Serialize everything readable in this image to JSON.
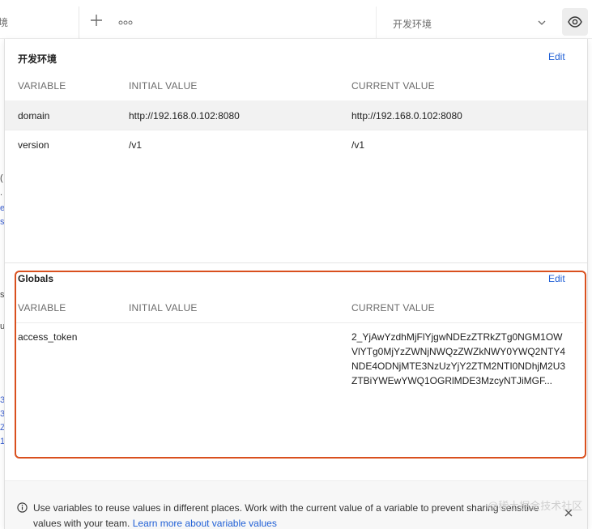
{
  "topbar": {
    "tab_fragment": "境",
    "environment_selected": "开发环境"
  },
  "background_peek": [
    "(",
    ".",
    "e",
    "s",
    "s",
    "u",
    "3",
    "3",
    "Z",
    "1"
  ],
  "environment": {
    "title": "开发环境",
    "edit_label": "Edit",
    "columns": [
      "VARIABLE",
      "INITIAL VALUE",
      "CURRENT VALUE"
    ],
    "rows": [
      {
        "variable": "domain",
        "initial": "http://192.168.0.102:8080",
        "current": "http://192.168.0.102:8080"
      },
      {
        "variable": "version",
        "initial": "/v1",
        "current": "/v1"
      }
    ]
  },
  "globals": {
    "title": "Globals",
    "edit_label": "Edit",
    "columns": [
      "VARIABLE",
      "INITIAL VALUE",
      "CURRENT VALUE"
    ],
    "rows": [
      {
        "variable": "access_token",
        "initial": "",
        "current": "2_YjAwYzdhMjFlYjgwNDEzZTRkZTg0NGM1OWVlYTg0MjYzZWNjNWQzZWZkNWY0YWQ2NTY4NDE4ODNjMTE3NzUzYjY2ZTM2NTI0NDhjM2U3ZTBiYWEwYWQ1OGRlMDE3MzcyNTJiMGF..."
      }
    ]
  },
  "footer": {
    "text": "Use variables to reuse values in different places. Work with the current value of a variable to prevent sharing sensitive values with your team.",
    "link": "Learn more about variable values"
  },
  "watermark": "@稀土掘金技术社区",
  "colors": {
    "accent": "#1f5fd6",
    "highlight_border": "#d9501e",
    "row_highlight": "#f2f2f2"
  }
}
